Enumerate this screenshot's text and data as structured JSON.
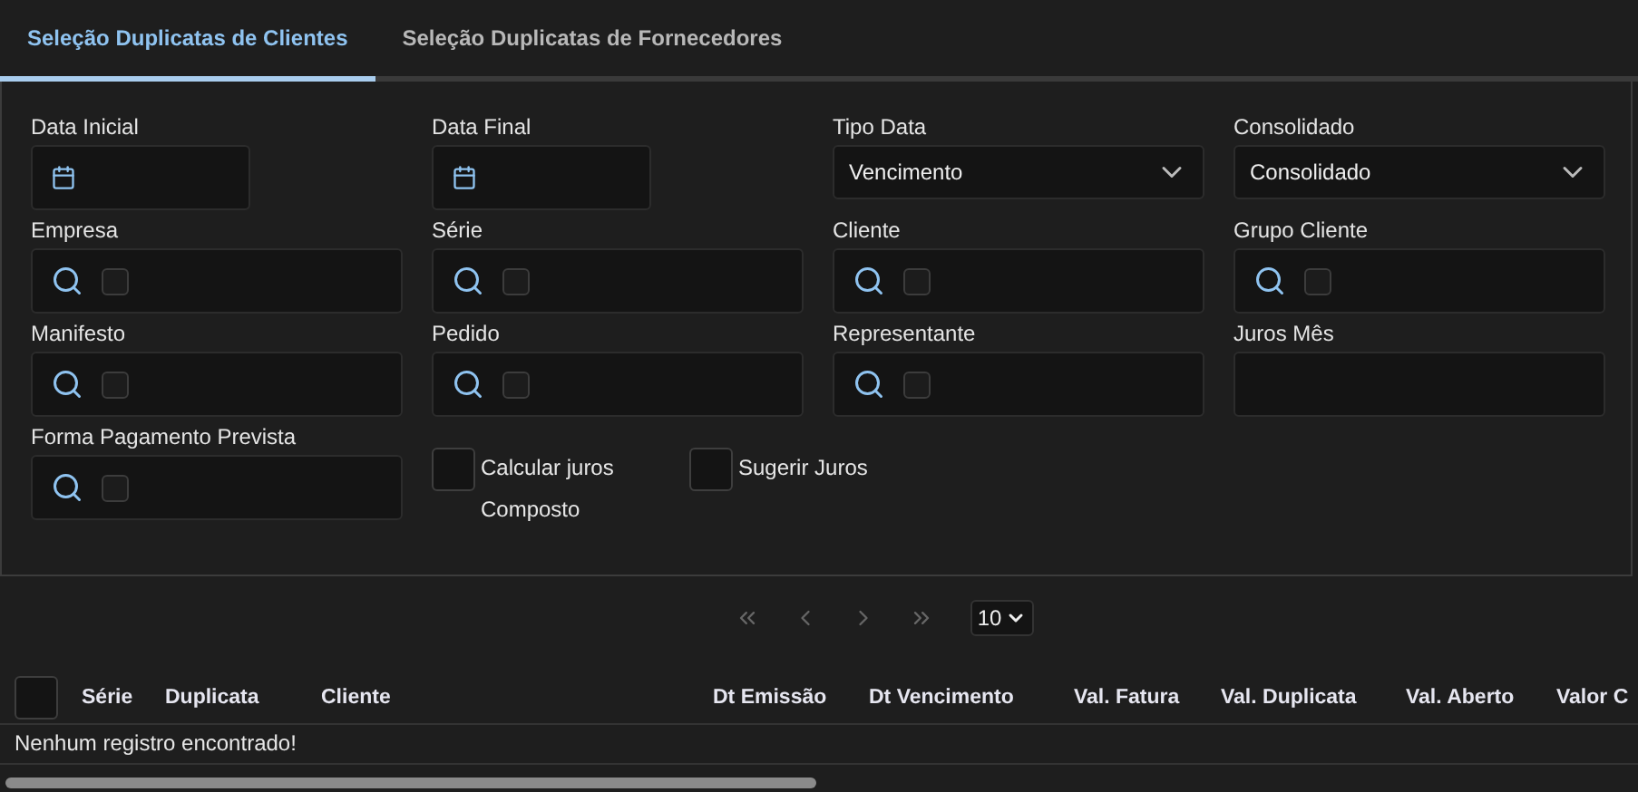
{
  "tabs": [
    {
      "label": "Seleção Duplicatas de Clientes",
      "selected": true
    },
    {
      "label": "Seleção Duplicatas de Fornecedores",
      "selected": false
    }
  ],
  "filters": [
    {
      "kind": "date",
      "label": "Data Inicial"
    },
    {
      "kind": "date",
      "label": "Data Final"
    },
    {
      "kind": "select",
      "label": "Tipo Data",
      "value": "Vencimento"
    },
    {
      "kind": "select",
      "label": "Consolidado",
      "value": "Consolidado"
    },
    {
      "kind": "lookup",
      "label": "Empresa",
      "checked": false
    },
    {
      "kind": "lookup",
      "label": "Série",
      "checked": false
    },
    {
      "kind": "lookup",
      "label": "Cliente",
      "checked": false
    },
    {
      "kind": "lookup",
      "label": "Grupo Cliente",
      "checked": false
    },
    {
      "kind": "lookup",
      "label": "Manifesto",
      "checked": false
    },
    {
      "kind": "lookup",
      "label": "Pedido",
      "checked": false
    },
    {
      "kind": "lookup",
      "label": "Representante",
      "checked": false
    },
    {
      "kind": "text",
      "label": "Juros Mês"
    },
    {
      "kind": "lookup",
      "label": "Forma Pagamento Prevista",
      "checked": false
    }
  ],
  "options": [
    {
      "label": "Calcular juros Composto",
      "checked": false
    },
    {
      "label": "Sugerir Juros",
      "checked": false
    }
  ],
  "pagination": {
    "page_size": "10"
  },
  "table": {
    "select_all": false,
    "columns": [
      "Série",
      "Duplicata",
      "Cliente",
      "Dt Emissão",
      "Dt Vencimento",
      "Val. Fatura",
      "Val. Duplicata",
      "Val. Aberto",
      "Valor C"
    ],
    "empty_message": "Nenhum registro encontrado!"
  }
}
